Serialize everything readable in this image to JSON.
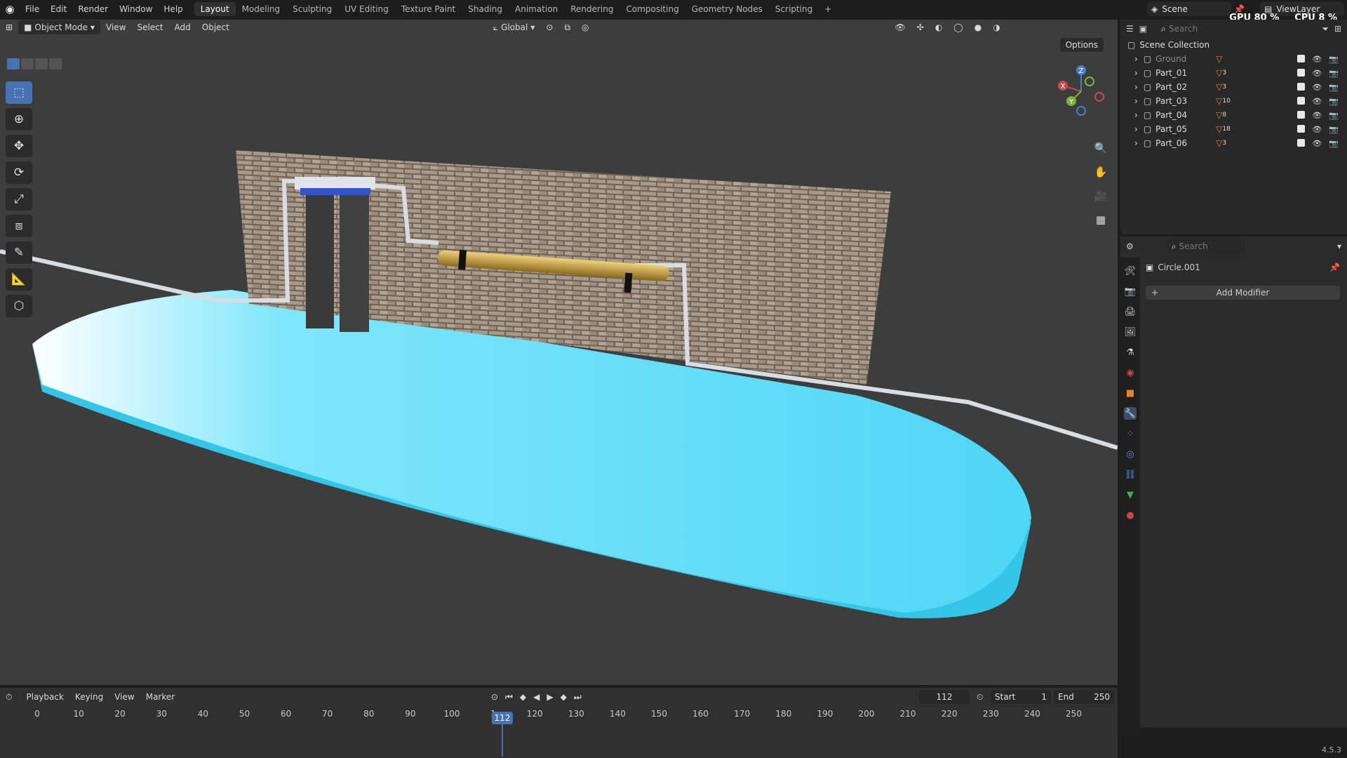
{
  "menu": {
    "items": [
      "File",
      "Edit",
      "Render",
      "Window",
      "Help"
    ]
  },
  "workspaces": {
    "tabs": [
      "Layout",
      "Modeling",
      "Sculpting",
      "UV Editing",
      "Texture Paint",
      "Shading",
      "Animation",
      "Rendering",
      "Compositing",
      "Geometry Nodes",
      "Scripting"
    ],
    "active": "Layout",
    "add": "+"
  },
  "scene": {
    "name": "Scene",
    "view_layer": "ViewLayer"
  },
  "stats": {
    "gpu_label": "GPU",
    "gpu_value": "80 %",
    "cpu_label": "CPU",
    "cpu_value": "8 %"
  },
  "viewport": {
    "mode": "Object Mode",
    "menus": [
      "View",
      "Select",
      "Add",
      "Object"
    ],
    "transform": "Global",
    "options": "Options",
    "axes": {
      "x": "X",
      "y": "Y",
      "z": "Z"
    }
  },
  "outliner": {
    "search_placeholder": "Search",
    "root": "Scene Collection",
    "items": [
      {
        "name": "Ground",
        "count": "",
        "dim": true
      },
      {
        "name": "Part_01",
        "count": "3"
      },
      {
        "name": "Part_02",
        "count": "3"
      },
      {
        "name": "Part_03",
        "count": "10"
      },
      {
        "name": "Part_04",
        "count": "8"
      },
      {
        "name": "Part_05",
        "count": "18"
      },
      {
        "name": "Part_06",
        "count": "3"
      }
    ]
  },
  "properties": {
    "search_placeholder": "Search",
    "object_name": "Circle.001",
    "add_modifier": "Add Modifier"
  },
  "timeline": {
    "menus": [
      "Playback",
      "Keying",
      "View",
      "Marker"
    ],
    "current_frame": "112",
    "start_label": "Start",
    "start": "1",
    "end_label": "End",
    "end": "250",
    "ticks": [
      "0",
      "10",
      "20",
      "30",
      "40",
      "50",
      "60",
      "70",
      "80",
      "90",
      "100",
      "1",
      "120",
      "130",
      "140",
      "150",
      "160",
      "170",
      "180",
      "190",
      "200",
      "210",
      "220",
      "230",
      "240",
      "250"
    ]
  },
  "version": "4.5.3",
  "colors": {
    "accent": "#4772b3",
    "platform": "#57d9f7",
    "brick": "#8a7b6a",
    "pipe": "#d8dde2",
    "tube": "#c9a84a"
  }
}
